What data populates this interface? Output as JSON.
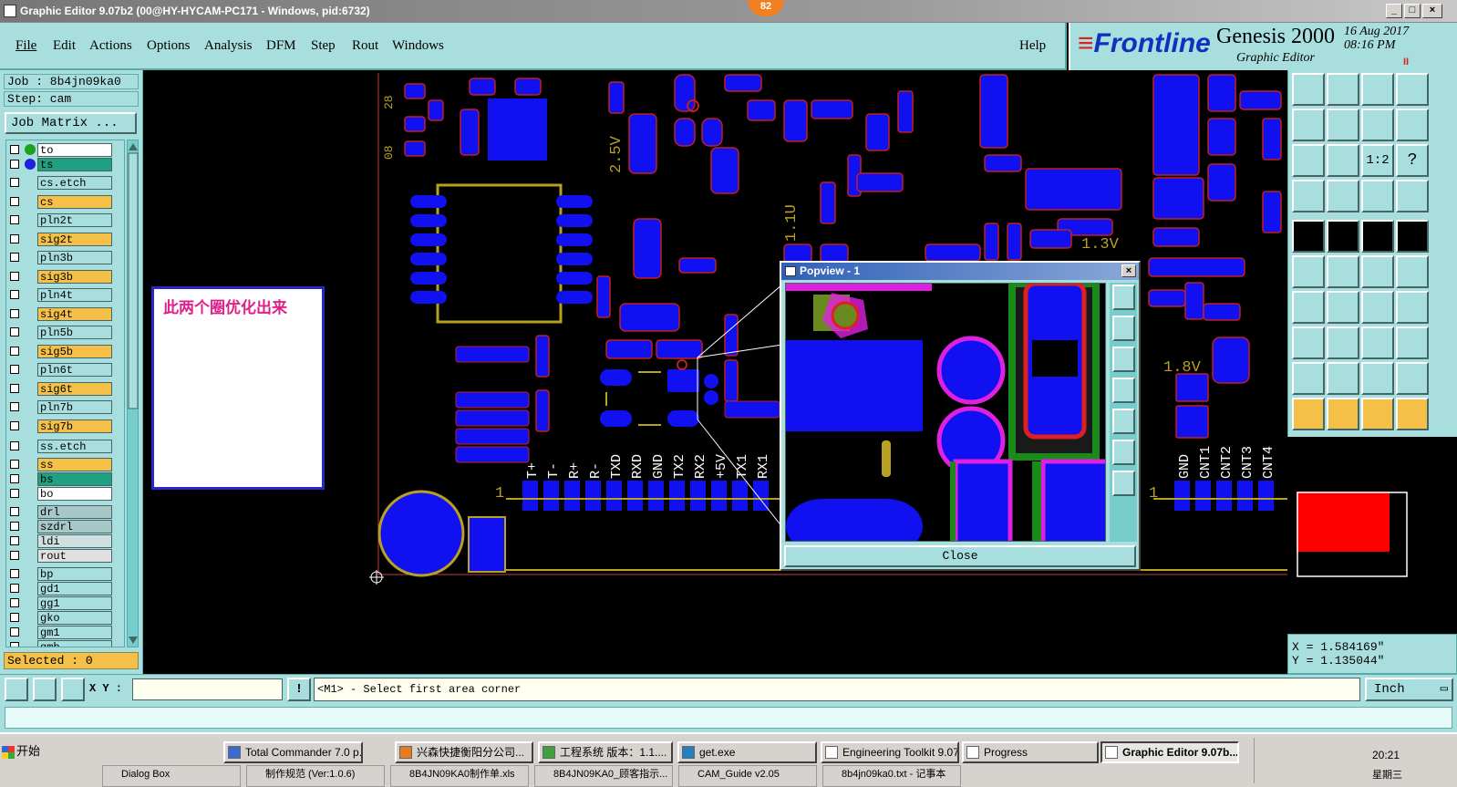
{
  "window": {
    "title": "Graphic Editor 9.07b2 (00@HY-HYCAM-PC171 - Windows, pid:6732)",
    "badge": "82",
    "min_label": "_",
    "max_label": "□",
    "close_label": "×"
  },
  "menu": {
    "items": [
      "File",
      "Edit",
      "Actions",
      "Options",
      "Analysis",
      "DFM",
      "Step",
      "Rout",
      "Windows"
    ],
    "help": "Help"
  },
  "brand": {
    "logo_main": "Frontline",
    "product": "Genesis 2000",
    "subtitle": "Graphic Editor",
    "date": "16 Aug 2017",
    "time": "08:16 PM",
    "pause_icon": "II",
    "colors": {
      "blue": "#1030c0",
      "red": "#e02020"
    }
  },
  "left": {
    "job": "Job : 8b4jn09ka0",
    "step": "Step: cam",
    "job_matrix": "Job Matrix ...",
    "selected": "Selected : 0",
    "layers": [
      {
        "name": "to",
        "color": "#ffffff",
        "dot": "#20a020"
      },
      {
        "name": "ts",
        "color": "#20a080",
        "dot": "#2020e0"
      },
      {
        "name": "cs.etch",
        "color": "#a8dede",
        "dot": ""
      },
      {
        "name": "cs",
        "color": "#f5c048",
        "dot": ""
      },
      {
        "name": "pln2t",
        "color": "#a8dede",
        "dot": ""
      },
      {
        "name": "sig2t",
        "color": "#f5c048",
        "dot": ""
      },
      {
        "name": "pln3b",
        "color": "#a8dede",
        "dot": ""
      },
      {
        "name": "sig3b",
        "color": "#f5c048",
        "dot": ""
      },
      {
        "name": "pln4t",
        "color": "#a8dede",
        "dot": ""
      },
      {
        "name": "sig4t",
        "color": "#f5c048",
        "dot": ""
      },
      {
        "name": "pln5b",
        "color": "#a8dede",
        "dot": ""
      },
      {
        "name": "sig5b",
        "color": "#f5c048",
        "dot": ""
      },
      {
        "name": "pln6t",
        "color": "#a8dede",
        "dot": ""
      },
      {
        "name": "sig6t",
        "color": "#f5c048",
        "dot": ""
      },
      {
        "name": "pln7b",
        "color": "#a8dede",
        "dot": ""
      },
      {
        "name": "sig7b",
        "color": "#f5c048",
        "dot": ""
      },
      {
        "name": "ss.etch",
        "color": "#a8dede",
        "dot": ""
      },
      {
        "name": "ss",
        "color": "#f5c048",
        "dot": ""
      },
      {
        "name": "bs",
        "color": "#20a080",
        "dot": ""
      },
      {
        "name": "bo",
        "color": "#ffffff",
        "dot": ""
      },
      {
        "name": "drl",
        "color": "#a8c8c8",
        "dot": ""
      },
      {
        "name": "szdrl",
        "color": "#a8c8c8",
        "dot": ""
      },
      {
        "name": "ldi",
        "color": "#d0e0e0",
        "dot": ""
      },
      {
        "name": "rout",
        "color": "#e0e0e0",
        "dot": ""
      },
      {
        "name": "bp",
        "color": "#a8dede",
        "dot": ""
      },
      {
        "name": "gd1",
        "color": "#a8dede",
        "dot": ""
      },
      {
        "name": "gg1",
        "color": "#a8dede",
        "dot": ""
      },
      {
        "name": "gko",
        "color": "#a8dede",
        "dot": ""
      },
      {
        "name": "gm1",
        "color": "#a8dede",
        "dot": ""
      },
      {
        "name": "gmb",
        "color": "#a8dede",
        "dot": ""
      }
    ]
  },
  "canvas": {
    "note_text": "此两个圈优化出来",
    "silk_labels": [
      "2.5V",
      "1.1U",
      "1.3V",
      "1.8V",
      "T+",
      "T-",
      "R+",
      "R-",
      "TXD",
      "RXD",
      "GND",
      "TX2",
      "RX2",
      "+5V",
      "TX1",
      "RX1",
      "GND",
      "CNT1",
      "CNT2",
      "CNT3",
      "CNT4",
      "1",
      "1",
      "1"
    ]
  },
  "popview": {
    "title": "Popview - 1",
    "close": "Close"
  },
  "coords": {
    "x": "X = 1.584169\"",
    "y": "Y = 1.135044\""
  },
  "cmd": {
    "xy_label": "X Y :",
    "xy_value": "",
    "bang": "!",
    "status": "<M1> - Select first area corner",
    "units": "Inch"
  },
  "taskbar": {
    "start": "开始",
    "items": [
      {
        "label": "Total Commander 7.0 p...",
        "active": false
      },
      {
        "label": "兴森快捷衡阳分公司...",
        "active": false
      },
      {
        "label": "工程系统  版本：1.1....",
        "active": false
      },
      {
        "label": "get.exe",
        "active": false
      },
      {
        "label": "Engineering Toolkit 9.07...",
        "active": false
      },
      {
        "label": "Progress",
        "active": false
      },
      {
        "label": "Graphic Editor 9.07b...",
        "active": true
      }
    ],
    "row2": [
      "Dialog Box",
      "制作规范 (Ver:1.0.6)",
      "8B4JN09KA0制作单.xls",
      "8B4JN09KA0_顾客指示...",
      "CAM_Guide v2.05",
      "8b4jn09ka0.txt - 记事本"
    ],
    "clock": "20:21",
    "clock2": "星期三"
  }
}
